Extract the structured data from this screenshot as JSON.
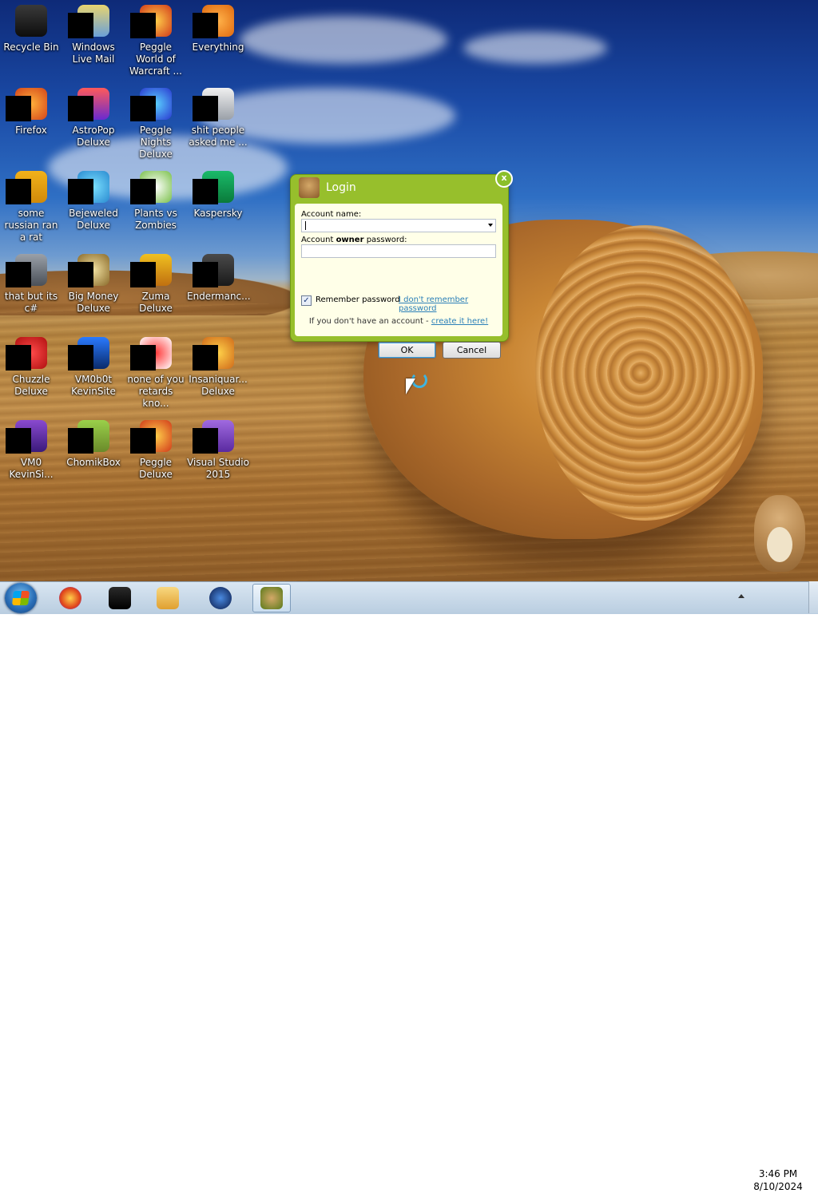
{
  "desktop": {
    "icons": [
      {
        "label": "Recycle Bin",
        "icon": "recycle-bin-icon"
      },
      {
        "label": "Windows Live Mail",
        "icon": "windows-live-mail-icon"
      },
      {
        "label": "Peggle World of Warcraft ...",
        "icon": "peggle-wow-icon"
      },
      {
        "label": "Everything",
        "icon": "everything-search-icon"
      },
      {
        "label": "Firefox",
        "icon": "firefox-icon"
      },
      {
        "label": "AstroPop Deluxe",
        "icon": "astropop-icon"
      },
      {
        "label": "Peggle Nights Deluxe",
        "icon": "peggle-nights-icon"
      },
      {
        "label": "shit people asked me ...",
        "icon": "folder-icon"
      },
      {
        "label": "some russian ran a rat",
        "icon": "orange-app-icon"
      },
      {
        "label": "Bejeweled Deluxe",
        "icon": "bejeweled-icon"
      },
      {
        "label": "Plants vs Zombies",
        "icon": "plants-vs-zombies-icon"
      },
      {
        "label": "Kaspersky",
        "icon": "kaspersky-icon"
      },
      {
        "label": "that but its c#",
        "icon": "stacked-windows-icon"
      },
      {
        "label": "Big Money Deluxe",
        "icon": "big-money-icon"
      },
      {
        "label": "Zuma Deluxe",
        "icon": "zuma-icon"
      },
      {
        "label": "Endermanc...",
        "icon": "endermanch-icon"
      },
      {
        "label": "Chuzzle Deluxe",
        "icon": "chuzzle-icon"
      },
      {
        "label": "VM0b0t KevinSite",
        "icon": "vm-monitor-icon"
      },
      {
        "label": "none of you retards kno...",
        "icon": "red-app-icon"
      },
      {
        "label": "Insaniquar... Deluxe",
        "icon": "insaniquarium-icon"
      },
      {
        "label": "VM0 KevinSi...",
        "icon": "purple-app-icon"
      },
      {
        "label": "ChomikBox",
        "icon": "chomikbox-icon"
      },
      {
        "label": "Peggle Deluxe",
        "icon": "peggle-deluxe-icon"
      },
      {
        "label": "Visual Studio 2015",
        "icon": "visual-studio-icon"
      }
    ]
  },
  "login_dialog": {
    "title": "Login",
    "close_glyph": "x",
    "account_name_label": "Account name:",
    "account_name_value": "",
    "password_label_pre": "Account ",
    "password_label_bold": "owner",
    "password_label_post": " password:",
    "password_value": "",
    "remember_label": "Remember password",
    "remember_checked": true,
    "forgot_link": "I don't remember password",
    "signup_text": "If you don't have an account - ",
    "signup_link": "create it here!",
    "ok_label": "OK",
    "cancel_label": "Cancel",
    "accent_color": "#97bf2c"
  },
  "taskbar": {
    "items": [
      {
        "icon": "firefox-icon",
        "active": false
      },
      {
        "icon": "black-box-icon",
        "active": false
      },
      {
        "icon": "media-folder-icon",
        "active": false
      },
      {
        "icon": "globe-icon",
        "active": false
      },
      {
        "icon": "chomikbox-icon",
        "active": true
      }
    ],
    "clock_time": "3:46 PM",
    "clock_date": "8/10/2024"
  }
}
